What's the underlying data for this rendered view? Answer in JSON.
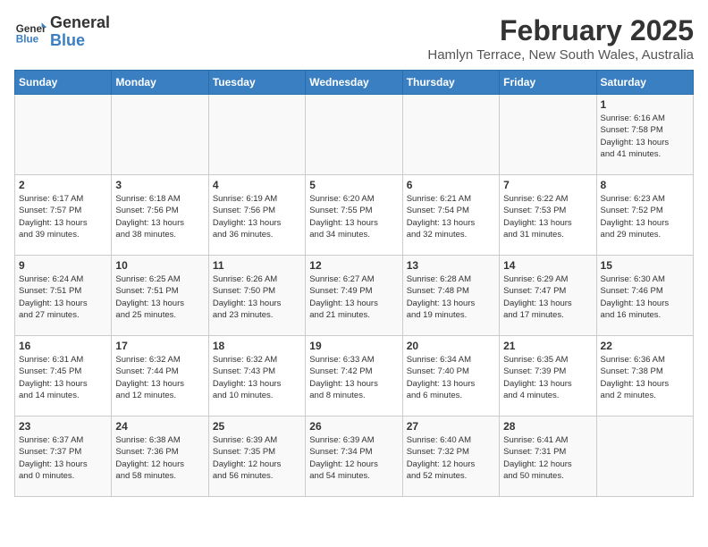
{
  "header": {
    "logo_general": "General",
    "logo_blue": "Blue",
    "title": "February 2025",
    "subtitle": "Hamlyn Terrace, New South Wales, Australia"
  },
  "columns": [
    "Sunday",
    "Monday",
    "Tuesday",
    "Wednesday",
    "Thursday",
    "Friday",
    "Saturday"
  ],
  "weeks": [
    [
      {
        "day": "",
        "info": ""
      },
      {
        "day": "",
        "info": ""
      },
      {
        "day": "",
        "info": ""
      },
      {
        "day": "",
        "info": ""
      },
      {
        "day": "",
        "info": ""
      },
      {
        "day": "",
        "info": ""
      },
      {
        "day": "1",
        "info": "Sunrise: 6:16 AM\nSunset: 7:58 PM\nDaylight: 13 hours\nand 41 minutes."
      }
    ],
    [
      {
        "day": "2",
        "info": "Sunrise: 6:17 AM\nSunset: 7:57 PM\nDaylight: 13 hours\nand 39 minutes."
      },
      {
        "day": "3",
        "info": "Sunrise: 6:18 AM\nSunset: 7:56 PM\nDaylight: 13 hours\nand 38 minutes."
      },
      {
        "day": "4",
        "info": "Sunrise: 6:19 AM\nSunset: 7:56 PM\nDaylight: 13 hours\nand 36 minutes."
      },
      {
        "day": "5",
        "info": "Sunrise: 6:20 AM\nSunset: 7:55 PM\nDaylight: 13 hours\nand 34 minutes."
      },
      {
        "day": "6",
        "info": "Sunrise: 6:21 AM\nSunset: 7:54 PM\nDaylight: 13 hours\nand 32 minutes."
      },
      {
        "day": "7",
        "info": "Sunrise: 6:22 AM\nSunset: 7:53 PM\nDaylight: 13 hours\nand 31 minutes."
      },
      {
        "day": "8",
        "info": "Sunrise: 6:23 AM\nSunset: 7:52 PM\nDaylight: 13 hours\nand 29 minutes."
      }
    ],
    [
      {
        "day": "9",
        "info": "Sunrise: 6:24 AM\nSunset: 7:51 PM\nDaylight: 13 hours\nand 27 minutes."
      },
      {
        "day": "10",
        "info": "Sunrise: 6:25 AM\nSunset: 7:51 PM\nDaylight: 13 hours\nand 25 minutes."
      },
      {
        "day": "11",
        "info": "Sunrise: 6:26 AM\nSunset: 7:50 PM\nDaylight: 13 hours\nand 23 minutes."
      },
      {
        "day": "12",
        "info": "Sunrise: 6:27 AM\nSunset: 7:49 PM\nDaylight: 13 hours\nand 21 minutes."
      },
      {
        "day": "13",
        "info": "Sunrise: 6:28 AM\nSunset: 7:48 PM\nDaylight: 13 hours\nand 19 minutes."
      },
      {
        "day": "14",
        "info": "Sunrise: 6:29 AM\nSunset: 7:47 PM\nDaylight: 13 hours\nand 17 minutes."
      },
      {
        "day": "15",
        "info": "Sunrise: 6:30 AM\nSunset: 7:46 PM\nDaylight: 13 hours\nand 16 minutes."
      }
    ],
    [
      {
        "day": "16",
        "info": "Sunrise: 6:31 AM\nSunset: 7:45 PM\nDaylight: 13 hours\nand 14 minutes."
      },
      {
        "day": "17",
        "info": "Sunrise: 6:32 AM\nSunset: 7:44 PM\nDaylight: 13 hours\nand 12 minutes."
      },
      {
        "day": "18",
        "info": "Sunrise: 6:32 AM\nSunset: 7:43 PM\nDaylight: 13 hours\nand 10 minutes."
      },
      {
        "day": "19",
        "info": "Sunrise: 6:33 AM\nSunset: 7:42 PM\nDaylight: 13 hours\nand 8 minutes."
      },
      {
        "day": "20",
        "info": "Sunrise: 6:34 AM\nSunset: 7:40 PM\nDaylight: 13 hours\nand 6 minutes."
      },
      {
        "day": "21",
        "info": "Sunrise: 6:35 AM\nSunset: 7:39 PM\nDaylight: 13 hours\nand 4 minutes."
      },
      {
        "day": "22",
        "info": "Sunrise: 6:36 AM\nSunset: 7:38 PM\nDaylight: 13 hours\nand 2 minutes."
      }
    ],
    [
      {
        "day": "23",
        "info": "Sunrise: 6:37 AM\nSunset: 7:37 PM\nDaylight: 13 hours\nand 0 minutes."
      },
      {
        "day": "24",
        "info": "Sunrise: 6:38 AM\nSunset: 7:36 PM\nDaylight: 12 hours\nand 58 minutes."
      },
      {
        "day": "25",
        "info": "Sunrise: 6:39 AM\nSunset: 7:35 PM\nDaylight: 12 hours\nand 56 minutes."
      },
      {
        "day": "26",
        "info": "Sunrise: 6:39 AM\nSunset: 7:34 PM\nDaylight: 12 hours\nand 54 minutes."
      },
      {
        "day": "27",
        "info": "Sunrise: 6:40 AM\nSunset: 7:32 PM\nDaylight: 12 hours\nand 52 minutes."
      },
      {
        "day": "28",
        "info": "Sunrise: 6:41 AM\nSunset: 7:31 PM\nDaylight: 12 hours\nand 50 minutes."
      },
      {
        "day": "",
        "info": ""
      }
    ]
  ]
}
